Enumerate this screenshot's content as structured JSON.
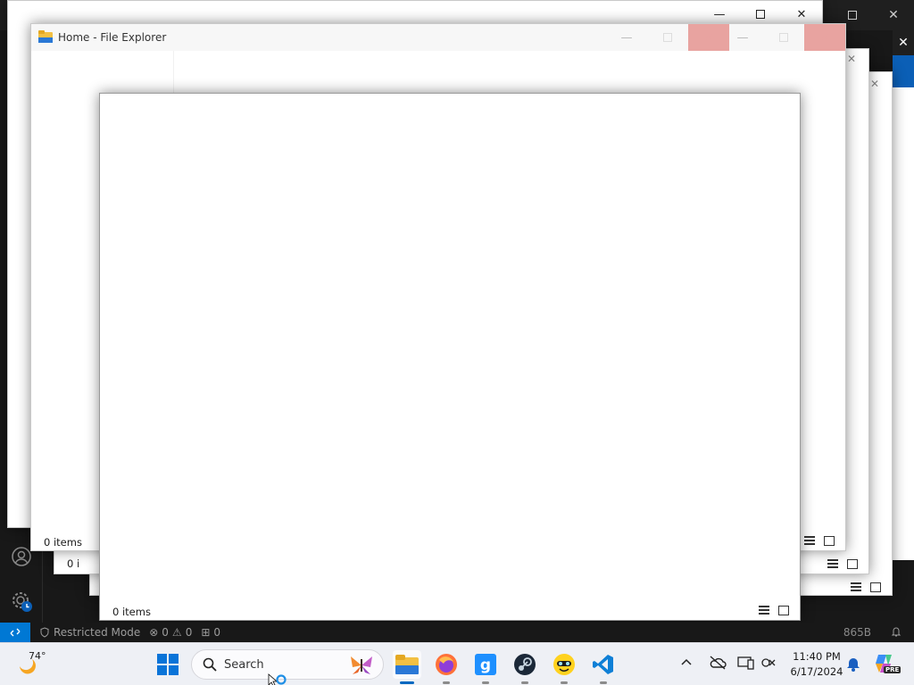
{
  "vscode": {
    "status": {
      "restricted_mode": "Restricted Mode",
      "errors": "0",
      "warnings": "0",
      "ports": "0",
      "size": "865B"
    }
  },
  "explorer": {
    "title": "Home - File Explorer",
    "item_count": "0 items",
    "stack_count_fragment": "0 i"
  },
  "taskbar": {
    "weather_temp": "74°",
    "search_placeholder": "Search",
    "pinned": [
      "start",
      "file-explorer",
      "firefox",
      "gmod",
      "steam",
      "pet-app",
      "vscode"
    ],
    "clock_time": "11:40 PM",
    "clock_date": "6/17/2024",
    "copilot_badge": "PRE"
  },
  "colors": {
    "accent": "#0078d4",
    "close_hover_faded": "#e8a3a0",
    "vscode_bg": "#181818"
  }
}
